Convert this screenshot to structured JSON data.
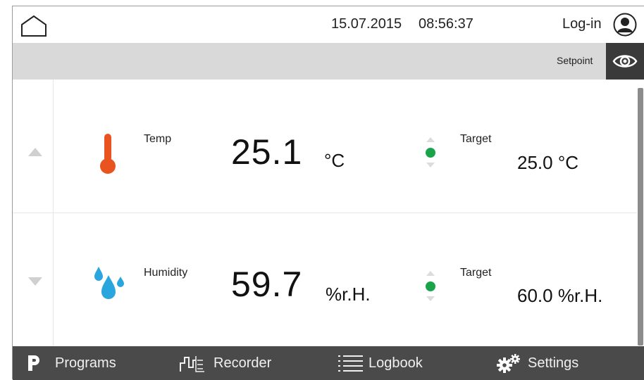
{
  "header": {
    "date": "15.07.2015",
    "time": "08:56:37",
    "login_label": "Log-in"
  },
  "setpoint_bar": {
    "label": "Setpoint"
  },
  "rows": [
    {
      "label": "Temp",
      "value": "25.1",
      "unit": "°C",
      "target_label": "Target",
      "target_value": "25.0 °C",
      "icon": "thermometer-icon",
      "status_color": "#1aa34a",
      "icon_color": "#e8531f"
    },
    {
      "label": "Humidity",
      "value": "59.7",
      "unit": "%r.H.",
      "target_label": "Target",
      "target_value": "60.0 %r.H.",
      "icon": "droplets-icon",
      "status_color": "#1aa34a",
      "icon_color": "#2aa6de"
    }
  ],
  "nav": {
    "programs": "Programs",
    "recorder": "Recorder",
    "logbook": "Logbook",
    "settings": "Settings"
  }
}
